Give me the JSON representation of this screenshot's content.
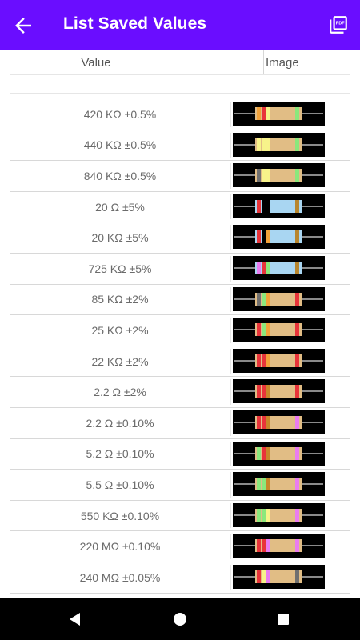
{
  "appbar": {
    "title": "List Saved Values",
    "back_icon": "arrow-left-icon",
    "pdf_icon": "pdf-export-icon"
  },
  "table": {
    "col_value": "Value",
    "col_image": "Image"
  },
  "colors": {
    "appbar": "#6a0dff",
    "resistor_body_standard": "#e1bd85",
    "resistor_body_blue": "#a9d6f2"
  },
  "rows": [
    {
      "value": "420 KΩ ±0.5%",
      "body": "standard",
      "bands": [
        "#f2a23a",
        "#e8343a",
        "#f7f38a",
        "#8be87c"
      ]
    },
    {
      "value": "440 KΩ ±0.5%",
      "body": "standard",
      "bands": [
        "#f7f38a",
        "#f7f38a",
        "#f7f38a",
        "#8be87c"
      ]
    },
    {
      "value": "840 KΩ ±0.5%",
      "body": "standard",
      "bands": [
        "#707070",
        "#f7f38a",
        "#f7f38a",
        "#8be87c"
      ]
    },
    {
      "value": "20 Ω ±5%",
      "body": "blue",
      "bands": [
        "#e8343a",
        "#000000",
        "#000000",
        "#b8862e"
      ]
    },
    {
      "value": "20 KΩ ±5%",
      "body": "blue",
      "bands": [
        "#e8343a",
        "#000000",
        "#f2a23a",
        "#b8862e"
      ]
    },
    {
      "value": "725 KΩ ±5%",
      "body": "blue",
      "bands": [
        "#ea7cf0",
        "#e8343a",
        "#8be87c",
        "#b8862e"
      ]
    },
    {
      "value": "85 KΩ ±2%",
      "body": "standard",
      "bands": [
        "#707070",
        "#8be87c",
        "#f2a23a",
        "#e8343a"
      ]
    },
    {
      "value": "25 KΩ ±2%",
      "body": "standard",
      "bands": [
        "#e8343a",
        "#8be87c",
        "#f2a23a",
        "#e8343a"
      ]
    },
    {
      "value": "22 KΩ ±2%",
      "body": "standard",
      "bands": [
        "#e8343a",
        "#e8343a",
        "#f2a23a",
        "#e8343a"
      ]
    },
    {
      "value": "2.2 Ω ±2%",
      "body": "standard",
      "bands": [
        "#e8343a",
        "#e8343a",
        "#c8872a",
        "#e8343a"
      ]
    },
    {
      "value": "2.2 Ω ±0.10%",
      "body": "standard",
      "bands": [
        "#e8343a",
        "#e8343a",
        "#c8872a",
        "#ea7cf0"
      ]
    },
    {
      "value": "5.2 Ω ±0.10%",
      "body": "standard",
      "bands": [
        "#8be87c",
        "#e8343a",
        "#c8872a",
        "#ea7cf0"
      ]
    },
    {
      "value": "5.5 Ω ±0.10%",
      "body": "standard",
      "bands": [
        "#8be87c",
        "#8be87c",
        "#c8872a",
        "#ea7cf0"
      ]
    },
    {
      "value": "550 KΩ ±0.10%",
      "body": "standard",
      "bands": [
        "#8be87c",
        "#8be87c",
        "#f7f38a",
        "#ea7cf0"
      ]
    },
    {
      "value": "220 MΩ ±0.10%",
      "body": "standard",
      "bands": [
        "#e8343a",
        "#e8343a",
        "#ea7cf0",
        "#ea7cf0"
      ]
    },
    {
      "value": "240 MΩ ±0.05%",
      "body": "standard",
      "bands": [
        "#e8343a",
        "#f7f38a",
        "#ea7cf0",
        "#707070"
      ]
    }
  ],
  "navbar": {
    "back_icon": "nav-back-triangle-icon",
    "home_icon": "nav-home-circle-icon",
    "recents_icon": "nav-recents-square-icon"
  }
}
